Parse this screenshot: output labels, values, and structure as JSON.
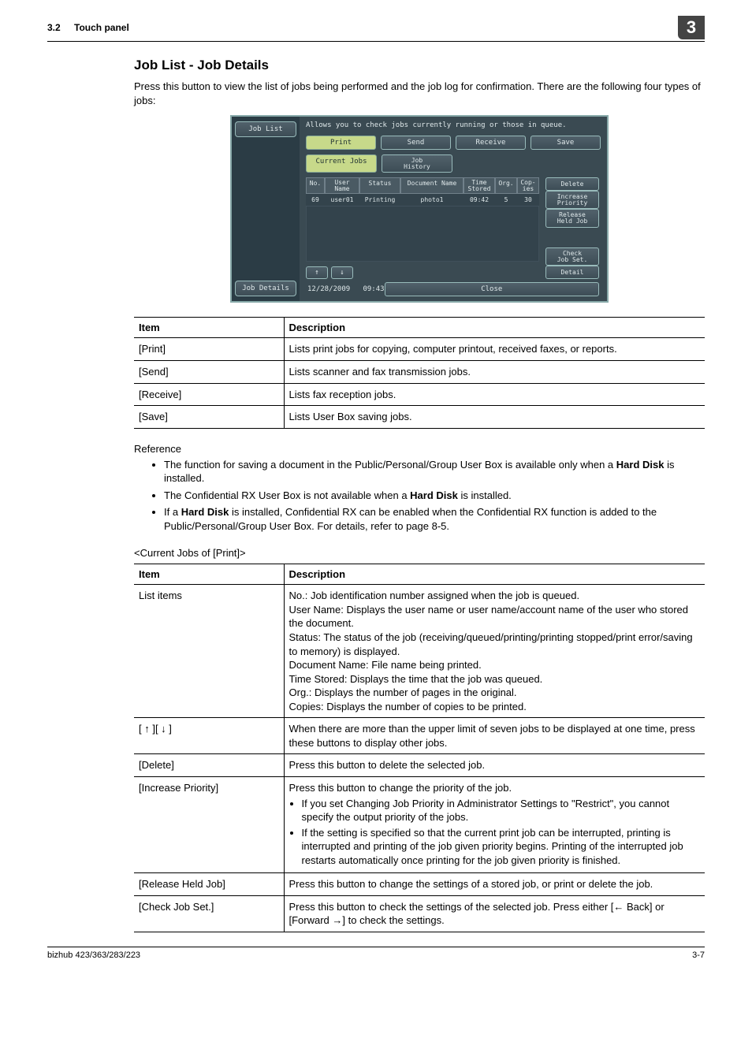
{
  "header": {
    "section_no": "3.2",
    "section_name": "Touch panel",
    "chapter_no": "3"
  },
  "title": "Job List - Job Details",
  "intro": "Press this button to view the list of jobs being performed and the job log for confirmation. There are the following four types of jobs:",
  "screenshot": {
    "left_top": "Job List",
    "left_bottom": "Job Details",
    "hint": "Allows you to check jobs currently running or those in queue.",
    "main_tabs": [
      "Print",
      "Send",
      "Receive",
      "Save"
    ],
    "main_tab_selected": 0,
    "sub_tabs": [
      "Current Jobs",
      "Job\nHistory"
    ],
    "sub_tab_selected": 0,
    "columns": [
      "No.",
      "User\nName",
      "Status",
      "Document Name",
      "Time\nStored",
      "Org.",
      "Cop-\nies"
    ],
    "row": {
      "no": "69",
      "user": "user01",
      "status": "Printing",
      "doc": "photo1",
      "time": "09:42",
      "org": "5",
      "copies": "30"
    },
    "side_buttons_top": [
      "Delete",
      "Increase\nPriority",
      "Release\nHeld Job"
    ],
    "side_buttons_bottom": [
      "Check\nJob Set.",
      "Detail"
    ],
    "arrows": [
      "↑",
      "↓"
    ],
    "date": "12/28/2009",
    "time": "09:43",
    "close": "Close"
  },
  "table1": {
    "headers": [
      "Item",
      "Description"
    ],
    "rows": [
      [
        "[Print]",
        "Lists print jobs for copying, computer printout, received faxes, or reports."
      ],
      [
        "[Send]",
        "Lists scanner and fax transmission jobs."
      ],
      [
        "[Receive]",
        "Lists fax reception jobs."
      ],
      [
        "[Save]",
        "Lists User Box saving jobs."
      ]
    ]
  },
  "reference_label": "Reference",
  "reference": [
    {
      "pre": "The function for saving a document in the Public/Personal/Group User Box is available only when a ",
      "bold": "Hard Disk",
      "post": " is installed."
    },
    {
      "pre": "The Confidential RX User Box is not available when a ",
      "bold": "Hard Disk",
      "post": " is installed."
    },
    {
      "pre": "If a ",
      "bold": "Hard Disk",
      "post": " is installed, Confidential RX can be enabled when the Confidential RX function is added to the Public/Personal/Group User Box. For details, refer to page 8-5."
    }
  ],
  "subhead": "<Current Jobs of [Print]>",
  "table2": {
    "headers": [
      "Item",
      "Description"
    ],
    "rows": [
      {
        "item": "List items",
        "desc_lines": [
          "No.: Job identification number assigned when the job is queued.",
          "User Name: Displays the user name or user name/account name of the user who stored the document.",
          "Status: The status of the job (receiving/queued/printing/printing stopped/print error/saving to memory) is displayed.",
          "Document Name: File name being printed.",
          "Time Stored: Displays the time that the job was queued.",
          "Org.: Displays the number of pages in the original.",
          "Copies: Displays the number of copies to be printed."
        ]
      },
      {
        "item": "[ ↑ ][ ↓ ]",
        "desc": "When there are more than the upper limit of seven jobs to be displayed at one time, press these buttons to display other jobs."
      },
      {
        "item": "[Delete]",
        "desc": "Press this button to delete the selected job."
      },
      {
        "item": "[Increase Priority]",
        "intro": "Press this button to change the priority of the job.",
        "bullets": [
          "If you set Changing Job Priority in Administrator Settings to \"Restrict\", you cannot specify the output priority of the jobs.",
          "If the setting is specified so that the current print job can be interrupted, printing is interrupted and printing of the job given priority begins. Printing of the interrupted job restarts automatically once printing for the job given priority is finished."
        ]
      },
      {
        "item": "[Release Held Job]",
        "desc": "Press this button to change the settings of a stored job, or print or delete the job."
      },
      {
        "item": "[Check Job Set.]",
        "desc": "Press this button to check the settings of the selected job. Press either [← Back] or [Forward →] to check the settings."
      }
    ]
  },
  "footer": {
    "left": "bizhub 423/363/283/223",
    "right": "3-7"
  }
}
